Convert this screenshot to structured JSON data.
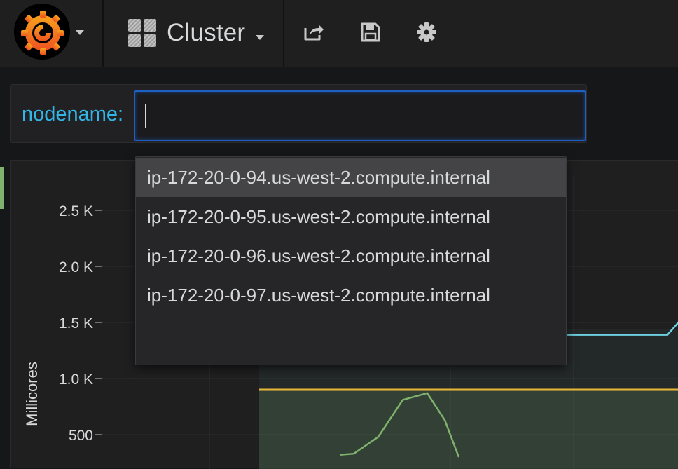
{
  "navbar": {
    "dashboard_title": "Cluster",
    "icons": {
      "logo": "grafana-logo-icon",
      "dashboards": "dashboard-grid-icon",
      "share": "share-icon",
      "save": "save-icon",
      "settings": "gear-icon"
    }
  },
  "template_variable": {
    "label": "nodename:",
    "value": ""
  },
  "dropdown": {
    "options": [
      "ip-172-20-0-94.us-west-2.compute.internal",
      "ip-172-20-0-95.us-west-2.compute.internal",
      "ip-172-20-0-96.us-west-2.compute.internal",
      "ip-172-20-0-97.us-west-2.compute.internal"
    ],
    "highlighted_index": 0
  },
  "chart_data": {
    "type": "line",
    "ylabel": "Millicores",
    "yticks": [
      "500",
      "1.0 K",
      "1.5 K",
      "2.0 K",
      "2.5 K"
    ],
    "ylim": [
      300,
      2650
    ],
    "grid": true,
    "series": [
      {
        "color": "#6ed0e0",
        "values": [
          1390,
          1390,
          1390,
          1390,
          1510
        ]
      },
      {
        "color": "#eab839",
        "values": [
          900,
          900
        ]
      },
      {
        "color": "#7eb26d",
        "values": [
          320,
          330,
          480,
          810,
          870,
          630,
          300
        ]
      }
    ]
  }
}
